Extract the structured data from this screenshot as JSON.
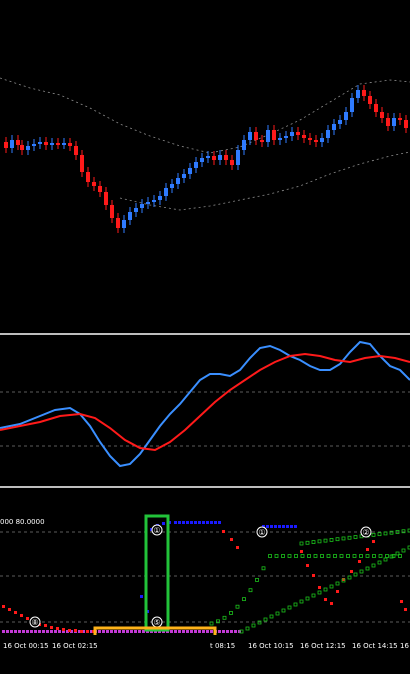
{
  "indicator_header": "000 80.0000",
  "time_axis": [
    {
      "label": "16 Oct 00:15"
    },
    {
      "label": "16 Oct 02:15"
    },
    {
      "label": "t 08:15"
    },
    {
      "label": "16 Oct 10:15"
    },
    {
      "label": "16 Oct 12:15"
    },
    {
      "label": "16 Oct 14:15"
    },
    {
      "label": "16"
    }
  ],
  "markers": [
    {
      "text": "①"
    },
    {
      "text": "①"
    },
    {
      "text": "②"
    },
    {
      "text": "⑤"
    },
    {
      "text": "⑧"
    }
  ],
  "colors": {
    "bull": "#2f7bff",
    "bear": "#ff1a1a",
    "osc_fast": "#3a8fff",
    "osc_slow": "#ff1a1a",
    "green_box": "#22c33a",
    "yellow_box": "#ffb31a",
    "dots_blue": "#1a1aff",
    "dots_red": "#ff1a1a",
    "dots_green": "#1cc31c",
    "dots_magenta": "#c33ad6"
  }
}
